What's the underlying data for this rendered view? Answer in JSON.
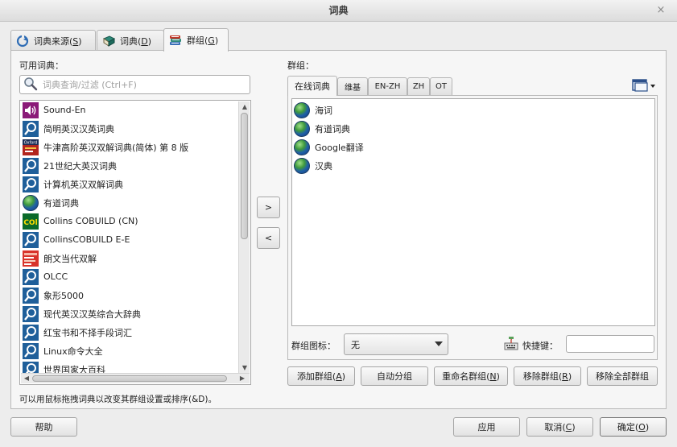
{
  "window": {
    "title": "词典",
    "close_glyph": "×"
  },
  "top_tabs": [
    {
      "label": "词典来源(",
      "accel": "S",
      "suffix": ")",
      "icon": "refresh-sources-icon"
    },
    {
      "label": "词典(",
      "accel": "D",
      "suffix": ")",
      "icon": "book-icon"
    },
    {
      "label": "群组(",
      "accel": "G",
      "suffix": ")",
      "icon": "books-stack-icon",
      "active": true
    }
  ],
  "available": {
    "label": "可用词典：",
    "search_placeholder": "词典查询/过滤 (Ctrl+F)",
    "items": [
      {
        "name": "Sound-En",
        "icon": "speaker-icon"
      },
      {
        "name": "简明英汉汉英词典",
        "icon": "magnifier-dict-icon"
      },
      {
        "name": "牛津高阶英汉双解词典(简体) 第 8 版",
        "icon": "oxford-book-icon",
        "icon_text": "Oxford"
      },
      {
        "name": "21世纪大英汉词典",
        "icon": "magnifier-dict-icon"
      },
      {
        "name": "计算机英汉双解词典",
        "icon": "magnifier-dict-icon"
      },
      {
        "name": "有道词典",
        "icon": "globe-icon"
      },
      {
        "name": "Collins COBUILD (CN)",
        "icon": "collins-icon",
        "icon_text": "COl"
      },
      {
        "name": "CollinsCOBUILD E-E",
        "icon": "magnifier-dict-icon"
      },
      {
        "name": "朗文当代双解",
        "icon": "longman-book-icon"
      },
      {
        "name": "OLCC",
        "icon": "magnifier-dict-icon"
      },
      {
        "name": "象形5000",
        "icon": "magnifier-dict-icon"
      },
      {
        "name": "现代英汉汉英综合大辞典",
        "icon": "magnifier-dict-icon"
      },
      {
        "name": "红宝书和不择手段词汇",
        "icon": "magnifier-dict-icon"
      },
      {
        "name": "Linux命令大全",
        "icon": "magnifier-dict-icon"
      },
      {
        "name": "世界国家大百科",
        "icon": "magnifier-dict-icon"
      }
    ]
  },
  "move_buttons": {
    "add": ">",
    "remove": "<"
  },
  "groups": {
    "label": "群组：",
    "tabs": [
      {
        "label": "在线词典",
        "active": true
      },
      {
        "label": "维基"
      },
      {
        "label": "EN-ZH"
      },
      {
        "label": "ZH"
      },
      {
        "label": "OT"
      }
    ],
    "active_items": [
      {
        "name": "海词",
        "icon": "globe-icon"
      },
      {
        "name": "有道词典",
        "icon": "globe-icon"
      },
      {
        "name": "Google翻译",
        "icon": "globe-icon"
      },
      {
        "name": "汉典",
        "icon": "globe-icon"
      }
    ],
    "icon_label": "群组图标：",
    "icon_value": "无",
    "shortcut_label": "快捷键：",
    "shortcut_value": ""
  },
  "group_buttons": [
    {
      "label": "添加群组(",
      "accel": "A",
      "suffix": ")"
    },
    {
      "label": "自动分组",
      "accel": "",
      "suffix": ""
    },
    {
      "label": "重命名群组(",
      "accel": "N",
      "suffix": ")"
    },
    {
      "label": "移除群组(",
      "accel": "R",
      "suffix": ")"
    },
    {
      "label": "移除全部群组",
      "accel": "",
      "suffix": ""
    }
  ],
  "hint": "可以用鼠标拖拽词典以改变其群组设置或排序(&D)。",
  "footer": {
    "help": "帮助",
    "apply": "应用",
    "cancel": {
      "label": "取消(",
      "accel": "C",
      "suffix": ")"
    },
    "ok": {
      "label": "确定(",
      "accel": "O",
      "suffix": ")"
    }
  },
  "colors": {
    "dict_icon_blue": "#1f5f9a",
    "speaker_purple": "#8b1a78",
    "oxford_red": "#b3251d",
    "collins_green": "#0a6a2a",
    "collins_yellow": "#ffde00"
  }
}
